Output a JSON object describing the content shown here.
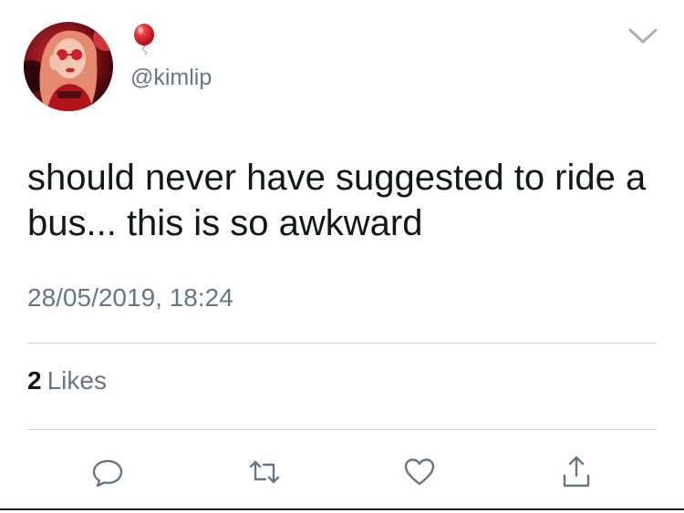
{
  "tweet": {
    "author": {
      "display_name_icon": "red-balloon-emoji-icon",
      "handle": "@kimlip",
      "avatar": "profile-avatar"
    },
    "text": "should never have suggested to ride a bus... this is so awkward",
    "timestamp": "28/05/2019, 18:24",
    "likes": {
      "count": "2",
      "label": "Likes"
    }
  },
  "actions": {
    "icons": [
      "reply-icon",
      "retweet-icon",
      "like-icon",
      "share-icon"
    ],
    "color": "#657786"
  },
  "menu": {
    "icon": "chevron-down-icon"
  },
  "colors": {
    "text": "#14171a",
    "secondary": "#657786",
    "divider": "#cfd4d8",
    "balloon": "#e0252e"
  }
}
